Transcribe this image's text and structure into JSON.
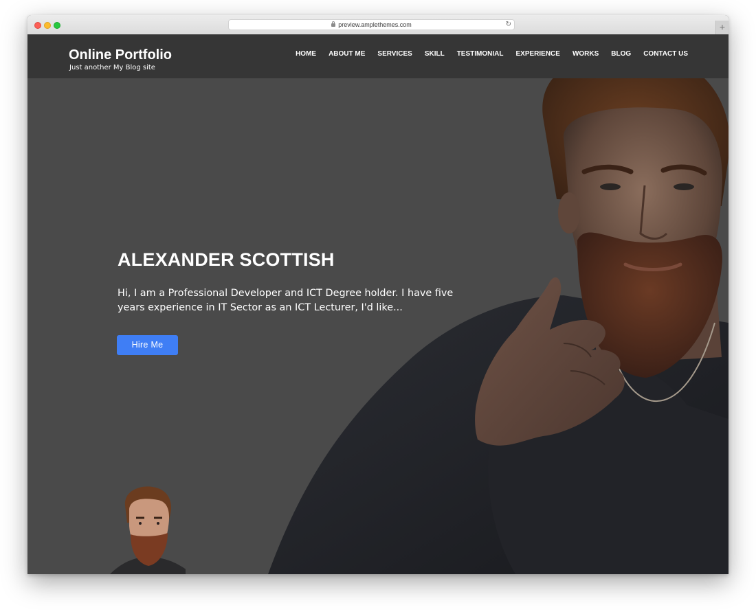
{
  "browser": {
    "url": "preview.amplethemes.com",
    "new_tab_label": "+"
  },
  "header": {
    "site_title": "Online Portfolio",
    "tagline": "Just another My Blog site"
  },
  "nav": {
    "items": [
      {
        "label": "HOME"
      },
      {
        "label": "ABOUT ME"
      },
      {
        "label": "SERVICES"
      },
      {
        "label": "SKILL"
      },
      {
        "label": "TESTIMONIAL"
      },
      {
        "label": "EXPERIENCE"
      },
      {
        "label": "WORKS"
      },
      {
        "label": "BLOG"
      },
      {
        "label": "CONTACT US"
      }
    ]
  },
  "hero": {
    "name": "ALEXANDER SCOTTISH",
    "description": "Hi, I am a Professional Developer and ICT Degree holder. I have five years experience in IT Sector as an ICT Lecturer, I'd like...",
    "cta_label": "Hire Me"
  },
  "colors": {
    "page_background": "#4a4a4a",
    "header_background": "#363636",
    "button_accent": "#3f7ef5",
    "text": "#ffffff"
  },
  "icons": {
    "lock": "lock-icon",
    "reload": "reload-icon"
  }
}
